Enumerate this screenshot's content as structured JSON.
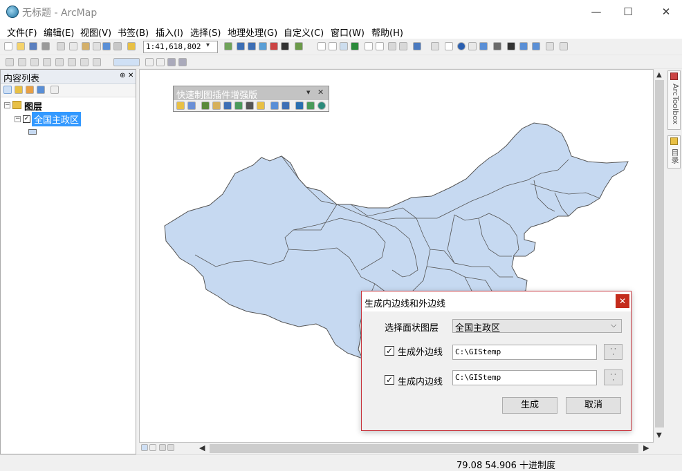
{
  "window": {
    "title": "无标题 - ArcMap",
    "min": "—",
    "max": "☐",
    "close": "✕"
  },
  "menu": [
    "文件(F)",
    "编辑(E)",
    "视图(V)",
    "书签(B)",
    "插入(I)",
    "选择(S)",
    "地理处理(G)",
    "自定义(C)",
    "窗口(W)",
    "帮助(H)"
  ],
  "toolbar": {
    "scale": "1:41,618,802"
  },
  "toc": {
    "title": "内容列表",
    "pin": "⊕",
    "close": "✕",
    "root": "图层",
    "layer": "全国主政区",
    "expand": "−"
  },
  "palette": {
    "title": "快速制图插件增强版",
    "dropdown": "▾",
    "close": "✕"
  },
  "dock_tabs": {
    "toolbox": "ArcToolbox",
    "catalog": "目录"
  },
  "dialog": {
    "title": "生成内边线和外边线",
    "close": "✕",
    "layer_label": "选择面状图层",
    "layer_value": "全国主政区",
    "outer_label": "生成外边线",
    "outer_checked": true,
    "outer_path": "C:\\GIStemp",
    "inner_label": "生成内边线",
    "inner_checked": true,
    "inner_path": "C:\\GIStemp",
    "browse": "· ·\n·",
    "generate": "生成",
    "cancel": "取消"
  },
  "status": {
    "coords": "79.08  54.906 十进制度"
  },
  "colors": {
    "map_fill": "#c6d9f1",
    "map_stroke": "#555555",
    "selected": "#3399ff"
  }
}
